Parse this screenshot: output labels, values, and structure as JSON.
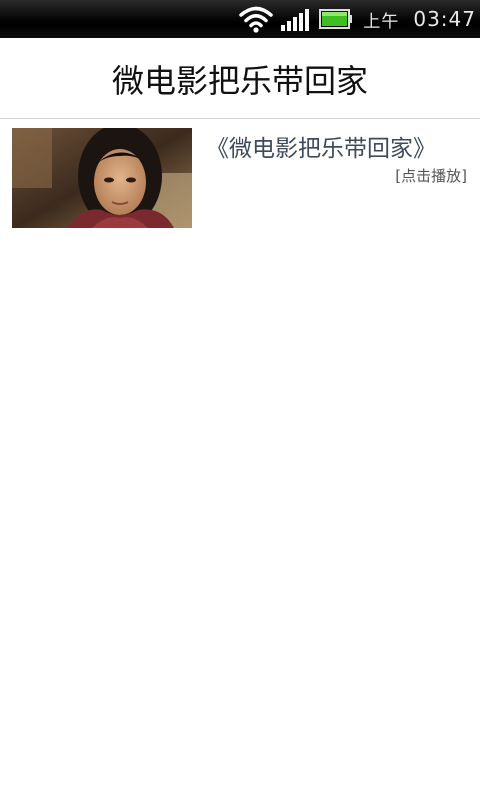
{
  "status_bar": {
    "ampm": "上午",
    "time": "03:47",
    "battery_color": "#3fbf1f"
  },
  "header": {
    "title": "微电影把乐带回家"
  },
  "videos": [
    {
      "title": "《微电影把乐带回家》",
      "play_label": "[点击播放]",
      "thumbnail": "person-portrait-thumbnail"
    }
  ],
  "colors": {
    "title_bar_bg": "#ffffff",
    "video_title": "#3f4a5c",
    "divider": "#d4d4d4"
  }
}
